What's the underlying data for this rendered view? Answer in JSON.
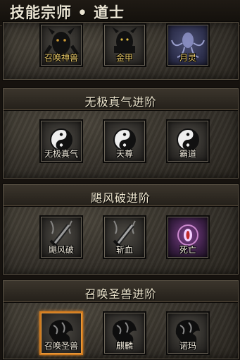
{
  "title": "技能宗师 • 道士",
  "sections": [
    {
      "header": "",
      "skills": [
        {
          "label": "召唤神兽",
          "icon": "beast-summon-icon"
        },
        {
          "label": "金甲",
          "icon": "golden-armor-icon"
        },
        {
          "label": "月灵",
          "icon": "moon-spirit-icon"
        }
      ]
    },
    {
      "header": "无极真气进阶",
      "skills": [
        {
          "label": "无极真气",
          "icon": "yin-yang-icon"
        },
        {
          "label": "天尊",
          "icon": "yin-yang-icon"
        },
        {
          "label": "霸道",
          "icon": "yin-yang-icon"
        }
      ]
    },
    {
      "header": "飓风破进阶",
      "skills": [
        {
          "label": "飓风破",
          "icon": "whirlwind-sword-icon"
        },
        {
          "label": "斩血",
          "icon": "blood-sword-icon"
        },
        {
          "label": "死亡",
          "icon": "death-eye-icon"
        }
      ]
    },
    {
      "header": "召唤圣兽进阶",
      "skills": [
        {
          "label": "召唤圣兽",
          "icon": "lion-head-icon",
          "selected": true
        },
        {
          "label": "麒麟",
          "icon": "qilin-head-icon"
        },
        {
          "label": "诺玛",
          "icon": "norma-head-icon"
        }
      ]
    }
  ]
}
